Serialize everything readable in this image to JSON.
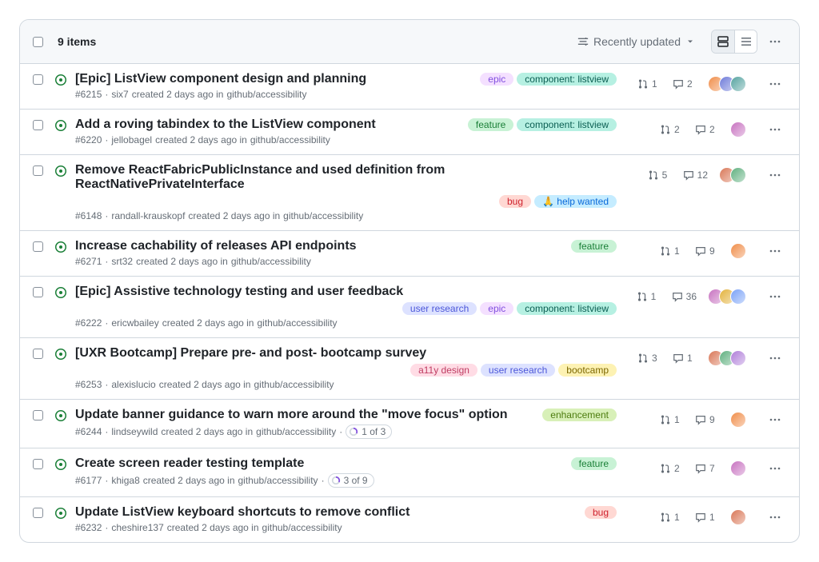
{
  "header": {
    "count_label": "9 items",
    "sort_label": "Recently updated"
  },
  "label_colors": {
    "epic": {
      "bg": "#f4e0ff",
      "fg": "#8250df"
    },
    "component: listview": {
      "bg": "#b6f0e2",
      "fg": "#0a5e52"
    },
    "feature": {
      "bg": "#c8f2d5",
      "fg": "#1a7f37"
    },
    "bug": {
      "bg": "#ffd8d3",
      "fg": "#cf222e"
    },
    "🙏 help wanted": {
      "bg": "#c5ecff",
      "fg": "#0969da"
    },
    "user research": {
      "bg": "#dde2ff",
      "fg": "#4c57d9"
    },
    "a11y design": {
      "bg": "#ffdce5",
      "fg": "#bf3d63"
    },
    "bootcamp": {
      "bg": "#fdf2b3",
      "fg": "#7d6800"
    },
    "enhancement": {
      "bg": "#d8f0b8",
      "fg": "#4d7c0f"
    }
  },
  "avatar_seeds": [
    "#f08d49",
    "#6e7bd9",
    "#55a3a0",
    "#c772c0",
    "#e3b23c",
    "#7aa2f7",
    "#d97757",
    "#5fb07f",
    "#b07fd9"
  ],
  "items": [
    {
      "title": "[Epic] ListView component design and planning",
      "number": "#6215",
      "author": "six7",
      "created": "created 2 days ago",
      "repo": "github/accessibility",
      "labels": [
        "epic",
        "component: listview"
      ],
      "prs": "1",
      "comments": "2",
      "assignees": 3
    },
    {
      "title": "Add a roving tabindex to the ListView component",
      "number": "#6220",
      "author": "jellobagel",
      "created": "created 2 days ago",
      "repo": "github/accessibility",
      "labels": [
        "feature",
        "component: listview"
      ],
      "prs": "2",
      "comments": "2",
      "assignees": 1
    },
    {
      "title": "Remove ReactFabricPublicInstance and used definition from ReactNativePrivateInterface",
      "number": "#6148",
      "author": "randall-krauskopf",
      "created": "created 2 days ago",
      "repo": "github/accessibility",
      "labels": [
        "bug",
        "🙏 help wanted"
      ],
      "prs": "5",
      "comments": "12",
      "assignees": 2
    },
    {
      "title": "Increase cachability of releases API endpoints",
      "number": "#6271",
      "author": "srt32",
      "created": "created 2 days ago",
      "repo": "github/accessibility",
      "labels": [
        "feature"
      ],
      "prs": "1",
      "comments": "9",
      "assignees": 1
    },
    {
      "title": "[Epic] Assistive technology testing and user feedback",
      "number": "#6222",
      "author": "ericwbailey",
      "created": "created 2 days ago",
      "repo": "github/accessibility",
      "labels": [
        "user research",
        "epic",
        "component: listview"
      ],
      "prs": "1",
      "comments": "36",
      "assignees": 3
    },
    {
      "title": "[UXR Bootcamp] Prepare pre- and post- bootcamp survey",
      "number": "#6253",
      "author": "alexislucio",
      "created": "created 2 days ago",
      "repo": "github/accessibility",
      "labels": [
        "a11y design",
        "user research",
        "bootcamp"
      ],
      "prs": "3",
      "comments": "1",
      "assignees": 3
    },
    {
      "title": "Update banner guidance to warn more around the \"move focus\" option",
      "number": "#6244",
      "author": "lindseywild",
      "created": "created 2 days ago",
      "repo": "github/accessibility",
      "labels": [
        "enhancement"
      ],
      "prs": "1",
      "comments": "9",
      "assignees": 1,
      "tracked": {
        "done": "1",
        "total": "3",
        "pct": 33
      }
    },
    {
      "title": "Create screen reader testing template",
      "number": "#6177",
      "author": "khiga8",
      "created": "created 2 days ago",
      "repo": "github/accessibility",
      "labels": [
        "feature"
      ],
      "prs": "2",
      "comments": "7",
      "assignees": 1,
      "tracked": {
        "done": "3",
        "total": "9",
        "pct": 33
      }
    },
    {
      "title": "Update ListView keyboard shortcuts to remove conflict",
      "number": "#6232",
      "author": "cheshire137",
      "created": "created 2 days ago",
      "repo": "github/accessibility",
      "labels": [
        "bug"
      ],
      "prs": "1",
      "comments": "1",
      "assignees": 1
    }
  ]
}
